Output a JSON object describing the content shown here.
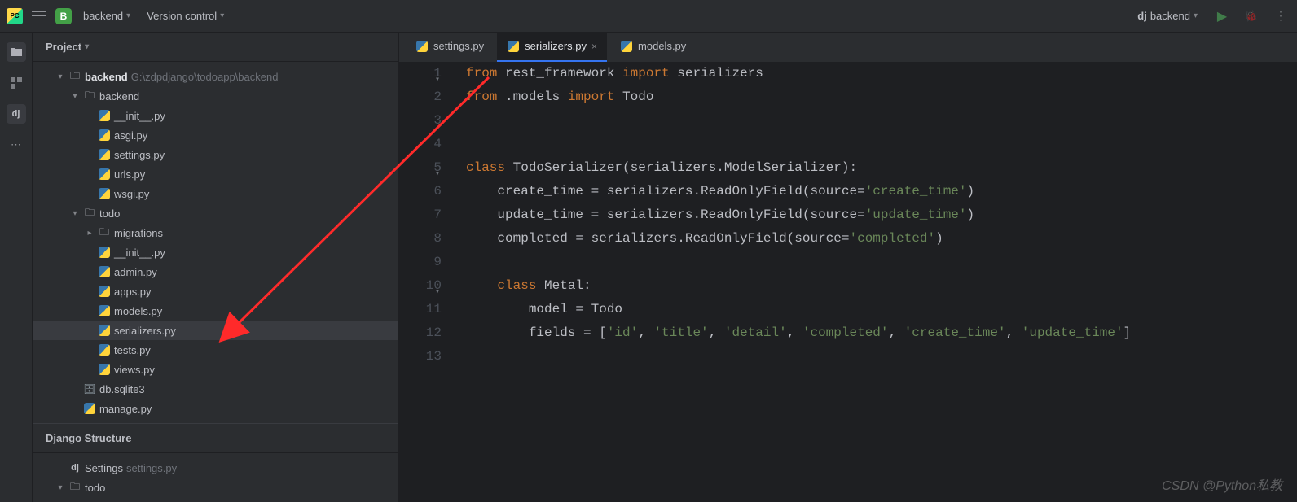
{
  "header": {
    "project_badge": "B",
    "project_name": "backend",
    "vcs_menu": "Version control",
    "run_config_prefix": "dj",
    "run_config_name": "backend"
  },
  "sidebar": {
    "panel_title": "Project",
    "tree": [
      {
        "indent": 0,
        "arrow": "down",
        "icon": "folder",
        "label": "backend",
        "suffix": "G:\\zdpdjango\\todoapp\\backend",
        "bold": true
      },
      {
        "indent": 1,
        "arrow": "down",
        "icon": "folder-module",
        "label": "backend"
      },
      {
        "indent": 2,
        "arrow": "none",
        "icon": "py",
        "label": "__init__.py"
      },
      {
        "indent": 2,
        "arrow": "none",
        "icon": "py",
        "label": "asgi.py"
      },
      {
        "indent": 2,
        "arrow": "none",
        "icon": "py",
        "label": "settings.py"
      },
      {
        "indent": 2,
        "arrow": "none",
        "icon": "py",
        "label": "urls.py"
      },
      {
        "indent": 2,
        "arrow": "none",
        "icon": "py",
        "label": "wsgi.py"
      },
      {
        "indent": 1,
        "arrow": "down",
        "icon": "folder-module",
        "label": "todo"
      },
      {
        "indent": 2,
        "arrow": "right",
        "icon": "folder-module",
        "label": "migrations"
      },
      {
        "indent": 2,
        "arrow": "none",
        "icon": "py",
        "label": "__init__.py"
      },
      {
        "indent": 2,
        "arrow": "none",
        "icon": "py",
        "label": "admin.py"
      },
      {
        "indent": 2,
        "arrow": "none",
        "icon": "py",
        "label": "apps.py"
      },
      {
        "indent": 2,
        "arrow": "none",
        "icon": "py",
        "label": "models.py"
      },
      {
        "indent": 2,
        "arrow": "none",
        "icon": "py",
        "label": "serializers.py",
        "selected": true
      },
      {
        "indent": 2,
        "arrow": "none",
        "icon": "py",
        "label": "tests.py"
      },
      {
        "indent": 2,
        "arrow": "none",
        "icon": "py",
        "label": "views.py"
      },
      {
        "indent": 1,
        "arrow": "none",
        "icon": "db",
        "label": "db.sqlite3"
      },
      {
        "indent": 1,
        "arrow": "none",
        "icon": "py",
        "label": "manage.py"
      }
    ],
    "django_panel_title": "Django Structure",
    "django_tree": [
      {
        "indent": 0,
        "arrow": "none",
        "icon": "dj",
        "label": "Settings",
        "suffix": "settings.py"
      },
      {
        "indent": 0,
        "arrow": "down",
        "icon": "folder",
        "label": "todo"
      }
    ]
  },
  "tabs": [
    {
      "label": "settings.py",
      "active": false
    },
    {
      "label": "serializers.py",
      "active": true
    },
    {
      "label": "models.py",
      "active": false
    }
  ],
  "code": {
    "lines": [
      {
        "n": 1,
        "fold": "down",
        "tokens": [
          {
            "t": "from ",
            "c": "kw"
          },
          {
            "t": "rest_framework ",
            "c": "ident"
          },
          {
            "t": "import ",
            "c": "kw"
          },
          {
            "t": "serializers",
            "c": "ident"
          }
        ]
      },
      {
        "n": 2,
        "tokens": [
          {
            "t": "from ",
            "c": "kw"
          },
          {
            "t": ".models ",
            "c": "ident"
          },
          {
            "t": "import ",
            "c": "kw"
          },
          {
            "t": "Todo",
            "c": "ident"
          }
        ]
      },
      {
        "n": 3,
        "tokens": []
      },
      {
        "n": 4,
        "tokens": []
      },
      {
        "n": 5,
        "fold": "down",
        "tokens": [
          {
            "t": "class ",
            "c": "kw"
          },
          {
            "t": "TodoSerializer(serializers.ModelSerializer):",
            "c": "cls"
          }
        ]
      },
      {
        "n": 6,
        "tokens": [
          {
            "t": "    create_time = serializers.ReadOnlyField(",
            "c": "ident"
          },
          {
            "t": "source",
            "c": "param"
          },
          {
            "t": "=",
            "c": "ident"
          },
          {
            "t": "'create_time'",
            "c": "str"
          },
          {
            "t": ")",
            "c": "ident"
          }
        ]
      },
      {
        "n": 7,
        "tokens": [
          {
            "t": "    update_time = serializers.ReadOnlyField(",
            "c": "ident"
          },
          {
            "t": "source",
            "c": "param"
          },
          {
            "t": "=",
            "c": "ident"
          },
          {
            "t": "'update_time'",
            "c": "str"
          },
          {
            "t": ")",
            "c": "ident"
          }
        ]
      },
      {
        "n": 8,
        "tokens": [
          {
            "t": "    completed = serializers.ReadOnlyField(",
            "c": "ident"
          },
          {
            "t": "source",
            "c": "param"
          },
          {
            "t": "=",
            "c": "ident"
          },
          {
            "t": "'completed'",
            "c": "str"
          },
          {
            "t": ")",
            "c": "ident"
          }
        ]
      },
      {
        "n": 9,
        "tokens": []
      },
      {
        "n": 10,
        "fold": "down",
        "tokens": [
          {
            "t": "    ",
            "c": "ident"
          },
          {
            "t": "class ",
            "c": "kw"
          },
          {
            "t": "Metal:",
            "c": "cls"
          }
        ]
      },
      {
        "n": 11,
        "tokens": [
          {
            "t": "        model = Todo",
            "c": "ident"
          }
        ]
      },
      {
        "n": 12,
        "tokens": [
          {
            "t": "        fields = [",
            "c": "ident"
          },
          {
            "t": "'id'",
            "c": "str"
          },
          {
            "t": ", ",
            "c": "ident"
          },
          {
            "t": "'title'",
            "c": "str"
          },
          {
            "t": ", ",
            "c": "ident"
          },
          {
            "t": "'detail'",
            "c": "str"
          },
          {
            "t": ", ",
            "c": "ident"
          },
          {
            "t": "'completed'",
            "c": "str"
          },
          {
            "t": ", ",
            "c": "ident"
          },
          {
            "t": "'create_time'",
            "c": "str"
          },
          {
            "t": ", ",
            "c": "ident"
          },
          {
            "t": "'update_time'",
            "c": "str"
          },
          {
            "t": "]",
            "c": "ident"
          }
        ]
      },
      {
        "n": 13,
        "tokens": []
      }
    ]
  },
  "watermark": "CSDN @Python私教"
}
